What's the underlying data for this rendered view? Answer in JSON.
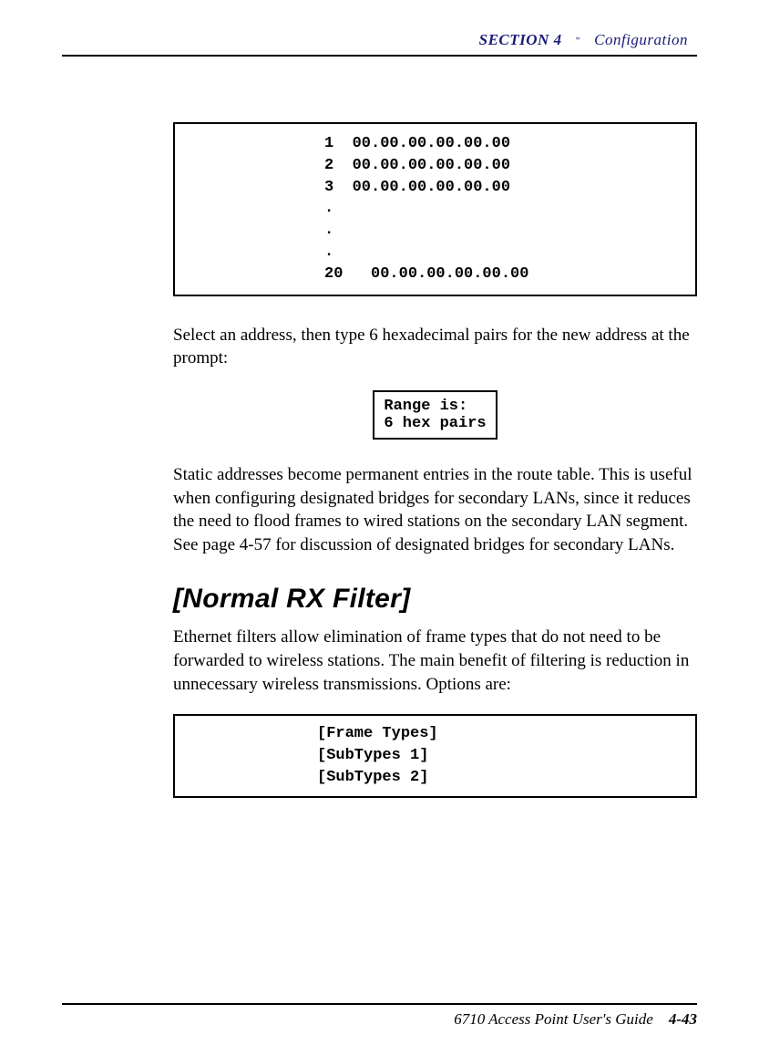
{
  "header": {
    "section": "SECTION 4",
    "title": "Configuration"
  },
  "addrbox": {
    "l1": "1  00.00.00.00.00.00",
    "l2": "2  00.00.00.00.00.00",
    "l3": "3  00.00.00.00.00.00",
    "l4": ".",
    "l5": ".",
    "l6": ".",
    "l7": "20   00.00.00.00.00.00"
  },
  "para1": "Select an address, then type 6 hexadecimal pairs for the new address at the prompt:",
  "rangebox": "Range is:\n6 hex pairs",
  "para2": "Static addresses become permanent entries in the route table.  This is useful when configuring designated bridges for secondary LANs, since it reduces the need to flood frames to wired stations on the secondary LAN segment.  See page 4-57 for discussion of designated bridges for secondary LANs.",
  "heading": "[Normal RX Filter]",
  "para3": "Ethernet filters allow elimination of frame types that do not need to be forwarded to wireless stations.  The main benefit of filtering is reduction in unnecessary wireless transmissions.  Options are:",
  "optbox": {
    "l1": "[Frame Types]",
    "l2": "[SubTypes 1]",
    "l3": "[SubTypes 2]"
  },
  "footer": {
    "guide": "6710 Access Point User's Guide",
    "pagenum": "4-43"
  }
}
